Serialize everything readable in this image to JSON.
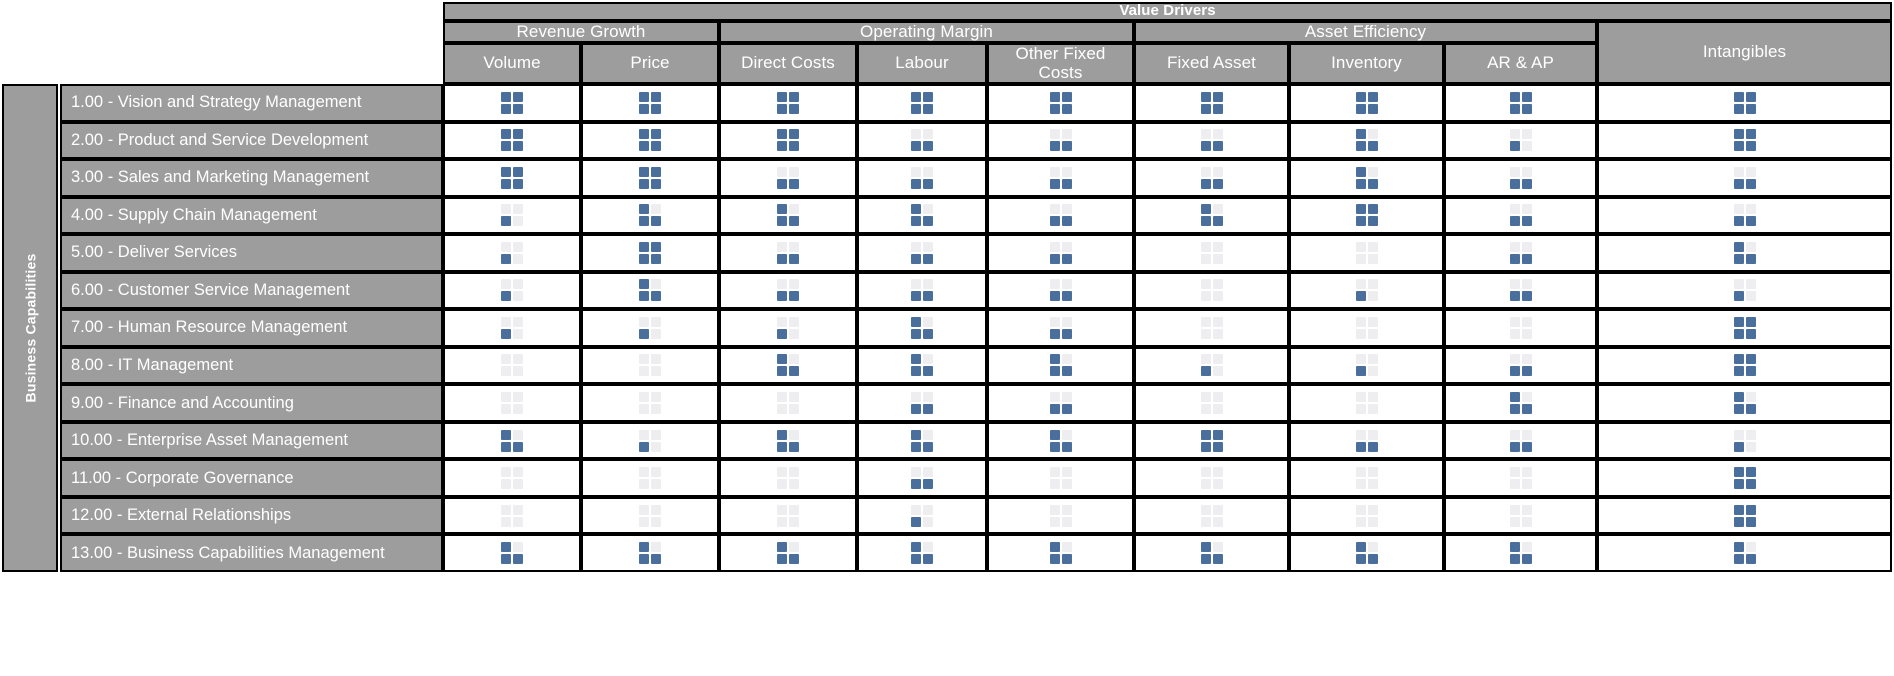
{
  "header": {
    "top_title": "Value Drivers",
    "groups": [
      {
        "label": "Revenue Growth"
      },
      {
        "label": "Operating Margin"
      },
      {
        "label": "Asset Efficiency"
      }
    ],
    "columns": [
      {
        "label": "Volume"
      },
      {
        "label": "Price"
      },
      {
        "label": "Direct Costs"
      },
      {
        "label": "Labour"
      },
      {
        "label": "Other Fixed Costs"
      },
      {
        "label": "Fixed Asset"
      },
      {
        "label": "Inventory"
      },
      {
        "label": "AR & AP"
      },
      {
        "label": "Intangibles"
      }
    ]
  },
  "side": {
    "axis_label": "Business Capabilities"
  },
  "colors": {
    "header_bg": "#9d9d9d",
    "header_text": "#ffffff",
    "grid_line": "#000000",
    "quadrant_on": "#4a6f9c",
    "quadrant_off": "#eeeef1",
    "cell_bg": "#ffffff"
  },
  "chart_data": {
    "type": "heatmap",
    "title": "Value Drivers",
    "xlabel": "Value Drivers",
    "ylabel": "Business Capabilities",
    "legend": "Each cell is a 2x2 quadrant glyph; filled quadrants (0-4) encode the strength of the linkage between a business capability and a value driver.",
    "scale": {
      "min": 0,
      "max": 4,
      "unit": "filled quadrants"
    },
    "quadrant_order": [
      "top-left",
      "top-right",
      "bottom-left",
      "bottom-right"
    ],
    "categories": [
      "Volume",
      "Price",
      "Direct Costs",
      "Labour",
      "Other Fixed Costs",
      "Fixed Asset",
      "Inventory",
      "AR & AP",
      "Intangibles"
    ],
    "rows": [
      {
        "label": "1.00 - Vision and Strategy Management",
        "values": [
          4,
          4,
          4,
          4,
          4,
          4,
          4,
          4,
          4
        ],
        "quadrants": [
          [
            1,
            1,
            1,
            1
          ],
          [
            1,
            1,
            1,
            1
          ],
          [
            1,
            1,
            1,
            1
          ],
          [
            1,
            1,
            1,
            1
          ],
          [
            1,
            1,
            1,
            1
          ],
          [
            1,
            1,
            1,
            1
          ],
          [
            1,
            1,
            1,
            1
          ],
          [
            1,
            1,
            1,
            1
          ],
          [
            1,
            1,
            1,
            1
          ]
        ]
      },
      {
        "label": "2.00 - Product and Service Development",
        "values": [
          4,
          4,
          4,
          2,
          2,
          2,
          3,
          1,
          4
        ],
        "quadrants": [
          [
            1,
            1,
            1,
            1
          ],
          [
            1,
            1,
            1,
            1
          ],
          [
            1,
            1,
            1,
            1
          ],
          [
            0,
            0,
            1,
            1
          ],
          [
            0,
            0,
            1,
            1
          ],
          [
            0,
            0,
            1,
            1
          ],
          [
            1,
            0,
            1,
            1
          ],
          [
            0,
            0,
            1,
            0
          ],
          [
            1,
            1,
            1,
            1
          ]
        ]
      },
      {
        "label": "3.00 - Sales and Marketing Management",
        "values": [
          4,
          4,
          2,
          2,
          2,
          2,
          3,
          2,
          2
        ],
        "quadrants": [
          [
            1,
            1,
            1,
            1
          ],
          [
            1,
            1,
            1,
            1
          ],
          [
            0,
            0,
            1,
            1
          ],
          [
            0,
            0,
            1,
            1
          ],
          [
            0,
            0,
            1,
            1
          ],
          [
            0,
            0,
            1,
            1
          ],
          [
            1,
            0,
            1,
            1
          ],
          [
            0,
            0,
            1,
            1
          ],
          [
            0,
            0,
            1,
            1
          ]
        ]
      },
      {
        "label": "4.00 - Supply Chain Management",
        "values": [
          1,
          3,
          3,
          3,
          2,
          3,
          4,
          2,
          2
        ],
        "quadrants": [
          [
            0,
            0,
            1,
            0
          ],
          [
            1,
            0,
            1,
            1
          ],
          [
            1,
            0,
            1,
            1
          ],
          [
            1,
            0,
            1,
            1
          ],
          [
            0,
            0,
            1,
            1
          ],
          [
            1,
            0,
            1,
            1
          ],
          [
            1,
            1,
            1,
            1
          ],
          [
            0,
            0,
            1,
            1
          ],
          [
            0,
            0,
            1,
            1
          ]
        ]
      },
      {
        "label": "5.00 - Deliver Services",
        "values": [
          1,
          4,
          2,
          2,
          2,
          0,
          0,
          2,
          3
        ],
        "quadrants": [
          [
            0,
            0,
            1,
            0
          ],
          [
            1,
            1,
            1,
            1
          ],
          [
            0,
            0,
            1,
            1
          ],
          [
            0,
            0,
            1,
            1
          ],
          [
            0,
            0,
            1,
            1
          ],
          [
            0,
            0,
            0,
            0
          ],
          [
            0,
            0,
            0,
            0
          ],
          [
            0,
            0,
            1,
            1
          ],
          [
            1,
            0,
            1,
            1
          ]
        ]
      },
      {
        "label": "6.00 - Customer Service Management",
        "values": [
          1,
          3,
          2,
          2,
          2,
          0,
          1,
          2,
          1
        ],
        "quadrants": [
          [
            0,
            0,
            1,
            0
          ],
          [
            1,
            0,
            1,
            1
          ],
          [
            0,
            0,
            1,
            1
          ],
          [
            0,
            0,
            1,
            1
          ],
          [
            0,
            0,
            1,
            1
          ],
          [
            0,
            0,
            0,
            0
          ],
          [
            0,
            0,
            1,
            0
          ],
          [
            0,
            0,
            1,
            1
          ],
          [
            0,
            0,
            1,
            0
          ]
        ]
      },
      {
        "label": "7.00 - Human Resource Management",
        "values": [
          1,
          1,
          1,
          3,
          2,
          0,
          0,
          0,
          4
        ],
        "quadrants": [
          [
            0,
            0,
            1,
            0
          ],
          [
            0,
            0,
            1,
            0
          ],
          [
            0,
            0,
            1,
            0
          ],
          [
            1,
            0,
            1,
            1
          ],
          [
            0,
            0,
            1,
            1
          ],
          [
            0,
            0,
            0,
            0
          ],
          [
            0,
            0,
            0,
            0
          ],
          [
            0,
            0,
            0,
            0
          ],
          [
            1,
            1,
            1,
            1
          ]
        ]
      },
      {
        "label": "8.00 - IT Management",
        "values": [
          0,
          0,
          3,
          3,
          3,
          1,
          1,
          2,
          4
        ],
        "quadrants": [
          [
            0,
            0,
            0,
            0
          ],
          [
            0,
            0,
            0,
            0
          ],
          [
            1,
            0,
            1,
            1
          ],
          [
            1,
            0,
            1,
            1
          ],
          [
            1,
            0,
            1,
            1
          ],
          [
            0,
            0,
            1,
            0
          ],
          [
            0,
            0,
            1,
            0
          ],
          [
            0,
            0,
            1,
            1
          ],
          [
            1,
            1,
            1,
            1
          ]
        ]
      },
      {
        "label": "9.00 - Finance and Accounting",
        "values": [
          0,
          0,
          0,
          2,
          2,
          0,
          0,
          3,
          3
        ],
        "quadrants": [
          [
            0,
            0,
            0,
            0
          ],
          [
            0,
            0,
            0,
            0
          ],
          [
            0,
            0,
            0,
            0
          ],
          [
            0,
            0,
            1,
            1
          ],
          [
            0,
            0,
            1,
            1
          ],
          [
            0,
            0,
            0,
            0
          ],
          [
            0,
            0,
            0,
            0
          ],
          [
            1,
            0,
            1,
            1
          ],
          [
            1,
            0,
            1,
            1
          ]
        ]
      },
      {
        "label": "10.00 - Enterprise Asset Management",
        "values": [
          3,
          1,
          3,
          3,
          3,
          4,
          2,
          2,
          1
        ],
        "quadrants": [
          [
            1,
            0,
            1,
            1
          ],
          [
            0,
            0,
            1,
            0
          ],
          [
            1,
            0,
            1,
            1
          ],
          [
            1,
            0,
            1,
            1
          ],
          [
            1,
            0,
            1,
            1
          ],
          [
            1,
            1,
            1,
            1
          ],
          [
            0,
            0,
            1,
            1
          ],
          [
            0,
            0,
            1,
            1
          ],
          [
            0,
            0,
            1,
            0
          ]
        ]
      },
      {
        "label": "11.00 - Corporate Governance",
        "values": [
          0,
          0,
          0,
          2,
          0,
          0,
          0,
          0,
          4
        ],
        "quadrants": [
          [
            0,
            0,
            0,
            0
          ],
          [
            0,
            0,
            0,
            0
          ],
          [
            0,
            0,
            0,
            0
          ],
          [
            0,
            0,
            1,
            1
          ],
          [
            0,
            0,
            0,
            0
          ],
          [
            0,
            0,
            0,
            0
          ],
          [
            0,
            0,
            0,
            0
          ],
          [
            0,
            0,
            0,
            0
          ],
          [
            1,
            1,
            1,
            1
          ]
        ]
      },
      {
        "label": "12.00 - External Relationships",
        "values": [
          0,
          0,
          0,
          1,
          0,
          0,
          0,
          0,
          4
        ],
        "quadrants": [
          [
            0,
            0,
            0,
            0
          ],
          [
            0,
            0,
            0,
            0
          ],
          [
            0,
            0,
            0,
            0
          ],
          [
            0,
            0,
            1,
            0
          ],
          [
            0,
            0,
            0,
            0
          ],
          [
            0,
            0,
            0,
            0
          ],
          [
            0,
            0,
            0,
            0
          ],
          [
            0,
            0,
            0,
            0
          ],
          [
            1,
            1,
            1,
            1
          ]
        ]
      },
      {
        "label": "13.00 - Business Capabilities Management",
        "values": [
          3,
          3,
          3,
          3,
          3,
          3,
          3,
          3,
          3
        ],
        "quadrants": [
          [
            1,
            0,
            1,
            1
          ],
          [
            1,
            0,
            1,
            1
          ],
          [
            1,
            0,
            1,
            1
          ],
          [
            1,
            0,
            1,
            1
          ],
          [
            1,
            0,
            1,
            1
          ],
          [
            1,
            0,
            1,
            1
          ],
          [
            1,
            0,
            1,
            1
          ],
          [
            1,
            0,
            1,
            1
          ],
          [
            1,
            0,
            1,
            1
          ]
        ]
      }
    ]
  }
}
